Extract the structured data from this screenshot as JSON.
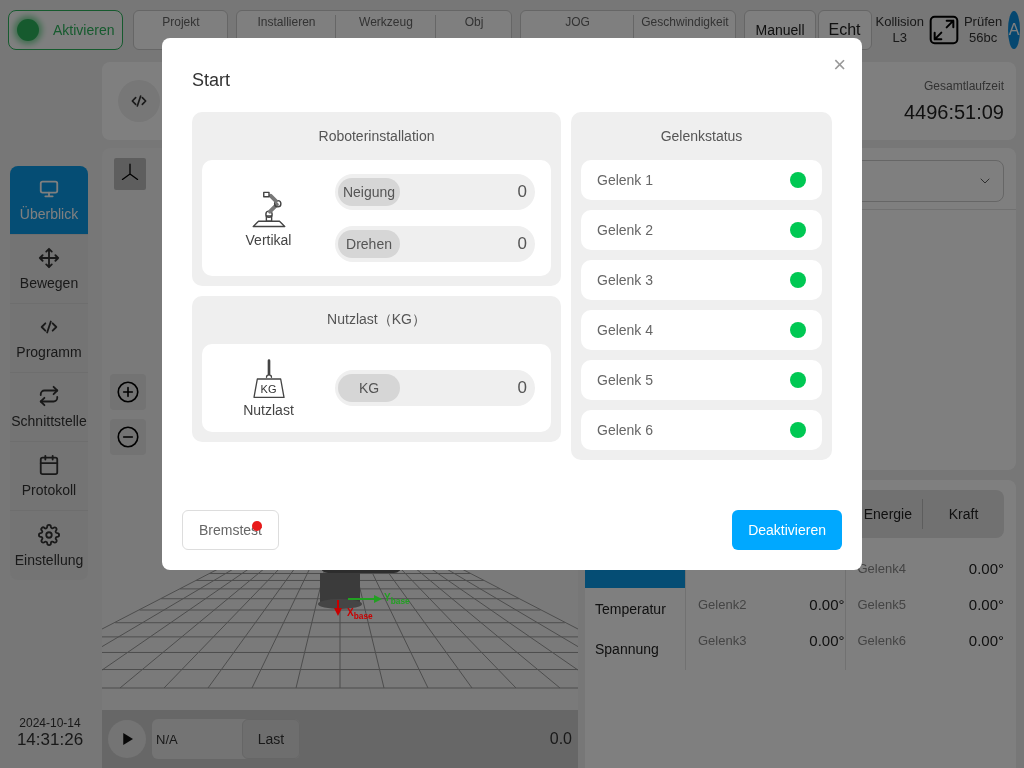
{
  "top_bar": {
    "activate_button": {
      "label": "Aktivieren",
      "on": true
    },
    "status_groups": [
      {
        "cells": [
          {
            "label": "Projekt"
          }
        ]
      },
      {
        "cells": [
          {
            "label": "Installieren"
          },
          {
            "label": "Werkzeug"
          },
          {
            "label": "Obj"
          }
        ]
      },
      {
        "cells": [
          {
            "label": "JOG"
          },
          {
            "label": "Geschwindigkeit"
          }
        ]
      }
    ],
    "mode_buttons": [
      "Manuell",
      "Echt"
    ],
    "collision": {
      "label": "Kollision",
      "value": "L3"
    },
    "check": {
      "label": "Prüfen",
      "value": "56bc"
    },
    "avatar": "A"
  },
  "program_card": {
    "runtime_label": "Gesamtlaufzeit",
    "runtime": "4496:51:09"
  },
  "sidebar": {
    "items": [
      {
        "label": "Überblick",
        "selected": true
      },
      {
        "label": "Bewegen",
        "selected": false
      },
      {
        "label": "Programm",
        "selected": false
      },
      {
        "label": "Schnittstelle",
        "selected": false
      },
      {
        "label": "Protokoll",
        "selected": false
      },
      {
        "label": "Einstellung",
        "selected": false
      }
    ]
  },
  "datetime": {
    "date": "2024-10-14",
    "time": "14:31:26"
  },
  "viewport": {
    "axes": [
      {
        "label": "X$_{base}$",
        "color": "#c80000"
      },
      {
        "label": "Y$_{base}$",
        "color": "#22a022"
      }
    ],
    "player": {
      "field": "N/A",
      "button": "Last",
      "value": "0.0"
    }
  },
  "data_panel": {
    "tabs": [
      {
        "label": "Energie",
        "selected": false
      },
      {
        "label": "Kraft",
        "selected": false
      }
    ],
    "side_tabs": [
      {
        "selected": true
      },
      {
        "label": "Temperatur",
        "selected": false
      },
      {
        "label": "Spannung",
        "selected": false
      }
    ],
    "joints": [
      {
        "name": "Gelenk2",
        "value": "0.00°"
      },
      {
        "name": "Gelenk3",
        "value": "0.00°"
      },
      {
        "name": "Gelenk4",
        "value": "0.00°"
      },
      {
        "name": "Gelenk5",
        "value": "0.00°"
      },
      {
        "name": "Gelenk6",
        "value": "0.00°"
      }
    ]
  },
  "dialog": {
    "title": "Start",
    "close": "×",
    "installation": {
      "title": "Roboterinstallation",
      "caption": "Vertikal",
      "fields": [
        {
          "label": "Neigung",
          "value": "0"
        },
        {
          "label": "Drehen",
          "value": "0"
        }
      ]
    },
    "payload": {
      "title": "Nutzlast（KG）",
      "icon_text": "KG",
      "caption": "Nutzlast",
      "fields": [
        {
          "label": "KG",
          "value": "0"
        }
      ]
    },
    "joint_status": {
      "title": "Gelenkstatus",
      "joints": [
        {
          "name": "Gelenk 1",
          "color": "#00c853"
        },
        {
          "name": "Gelenk 2",
          "color": "#00c853"
        },
        {
          "name": "Gelenk 3",
          "color": "#00c853"
        },
        {
          "name": "Gelenk 4",
          "color": "#00c853"
        },
        {
          "name": "Gelenk 5",
          "color": "#00c853"
        },
        {
          "name": "Gelenk 6",
          "color": "#00c853"
        }
      ]
    },
    "brake_test": {
      "label": "Bremstest",
      "alert": true
    },
    "deactivate": "Deaktivieren"
  }
}
